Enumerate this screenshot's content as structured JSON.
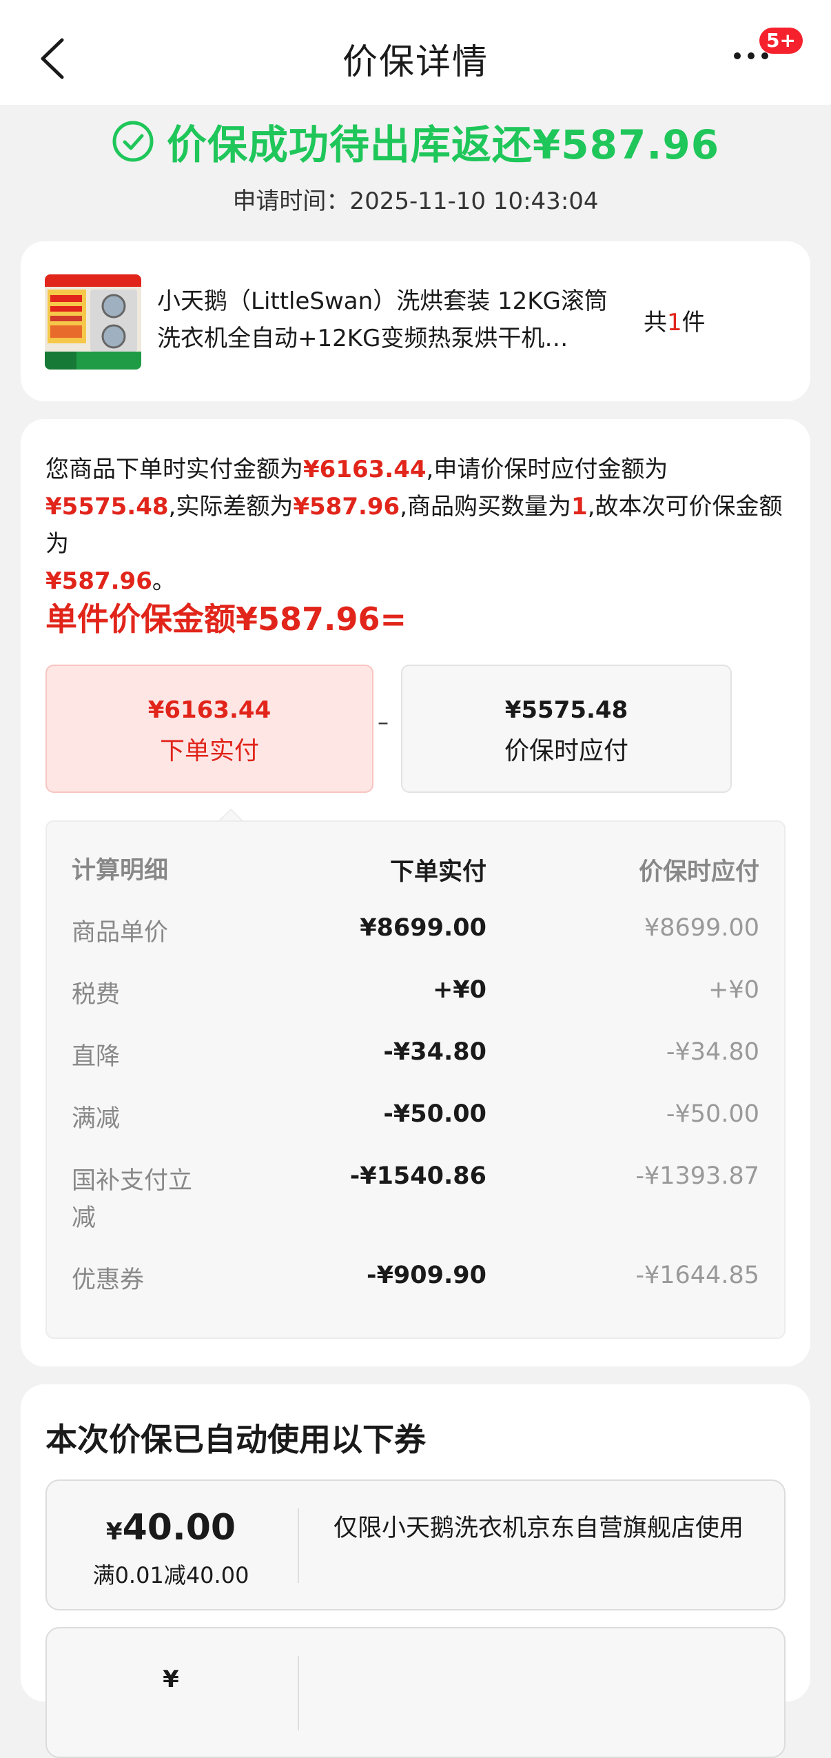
{
  "nav": {
    "title": "价保详情",
    "badge": "5+"
  },
  "status": {
    "text": "价保成功待出库返还¥587.96",
    "apply_time": "申请时间：2025-11-10 10:43:04",
    "color": "#1fc65a"
  },
  "product": {
    "name": "小天鹅（LittleSwan）洗烘套装 12KG滚筒洗衣机全自动+12KG变频热泵烘干机…",
    "qty_prefix": "共",
    "qty": "1",
    "qty_suffix": "件"
  },
  "detail": {
    "desc": {
      "p1": "您商品下单时实付金额为",
      "paid": "¥6163.44",
      "p2": ",申请价保时应付金额为",
      "now": "¥5575.48",
      "p3": ",实际差额为",
      "diff": "¥587.96",
      "p4": ",商品购买数量为",
      "count": "1",
      "p5": ",故本次可价保金额为",
      "refund": "¥587.96",
      "p6": "。"
    },
    "formula": "单件价保金额¥587.96=",
    "box_paid": {
      "amount": "¥6163.44",
      "label": "下单实付"
    },
    "minus": "–",
    "box_now": {
      "amount": "¥5575.48",
      "label": "价保时应付"
    },
    "table": {
      "headers": [
        "计算明细",
        "下单实付",
        "价保时应付"
      ],
      "rows": [
        {
          "label": "商品单价",
          "paid": "¥8699.00",
          "now": "¥8699.00"
        },
        {
          "label": "税费",
          "paid": "+¥0",
          "now": "+¥0"
        },
        {
          "label": "直降",
          "paid": "-¥34.80",
          "now": "-¥34.80"
        },
        {
          "label": "满减",
          "paid": "-¥50.00",
          "now": "-¥50.00"
        },
        {
          "label": "国补支付立减",
          "paid": "-¥1540.86",
          "now": "-¥1393.87"
        },
        {
          "label": "优惠券",
          "paid": "-¥909.90",
          "now": "-¥1644.85"
        }
      ]
    }
  },
  "coupons": {
    "title": "本次价保已自动使用以下券",
    "items": [
      {
        "yen": "¥",
        "amount": "40.00",
        "condition": "满0.01减40.00",
        "scope": "仅限小天鹅洗衣机京东自营旗舰店使用"
      },
      {
        "yen": "¥",
        "amount": "",
        "condition": "",
        "scope": ""
      }
    ]
  },
  "colors": {
    "accent_red": "#e1251b",
    "success_green": "#1fc65a",
    "badge_red": "#f5222d"
  }
}
